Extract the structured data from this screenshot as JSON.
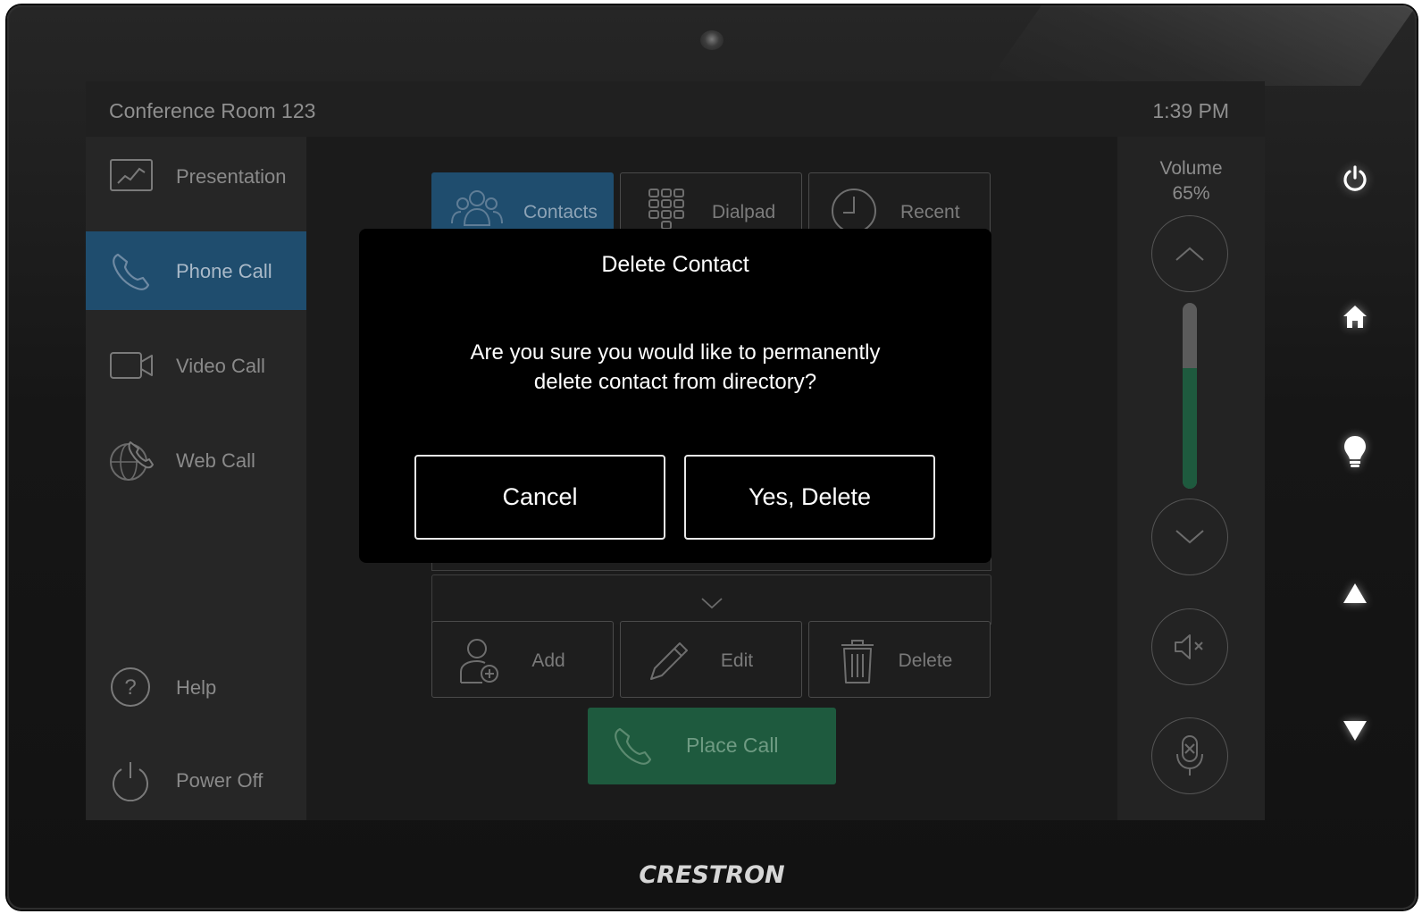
{
  "header": {
    "room_name": "Conference Room 123",
    "time": "1:39 PM"
  },
  "sidebar": {
    "items": [
      {
        "label": "Presentation",
        "icon": "presentation-chart-icon",
        "active": false
      },
      {
        "label": "Phone Call",
        "icon": "phone-icon",
        "active": true
      },
      {
        "label": "Video Call",
        "icon": "video-camera-icon",
        "active": false
      },
      {
        "label": "Web Call",
        "icon": "globe-phone-icon",
        "active": false
      },
      {
        "label": "Help",
        "icon": "help-icon",
        "active": false
      },
      {
        "label": "Power Off",
        "icon": "power-icon",
        "active": false
      }
    ]
  },
  "tabs": [
    {
      "label": "Contacts",
      "icon": "contacts-icon",
      "active": true
    },
    {
      "label": "Dialpad",
      "icon": "dialpad-icon",
      "active": false
    },
    {
      "label": "Recent",
      "icon": "clock-icon",
      "active": false
    }
  ],
  "actions": [
    {
      "label": "Add",
      "icon": "add-contact-icon"
    },
    {
      "label": "Edit",
      "icon": "pencil-icon"
    },
    {
      "label": "Delete",
      "icon": "trash-icon"
    }
  ],
  "place_call": {
    "label": "Place Call",
    "icon": "phone-icon"
  },
  "volume": {
    "label": "Volume",
    "value_text": "65%",
    "level": 0.65
  },
  "modal": {
    "title": "Delete Contact",
    "message_line1": "Are you sure you would like to permanently",
    "message_line2": "delete contact from directory?",
    "cancel_label": "Cancel",
    "confirm_label": "Yes, Delete"
  },
  "device": {
    "brand": "CRESTRON"
  },
  "colors": {
    "accent_blue": "#1f4d6e",
    "accent_green": "#1e5a3e",
    "modal_bg": "#000000"
  }
}
